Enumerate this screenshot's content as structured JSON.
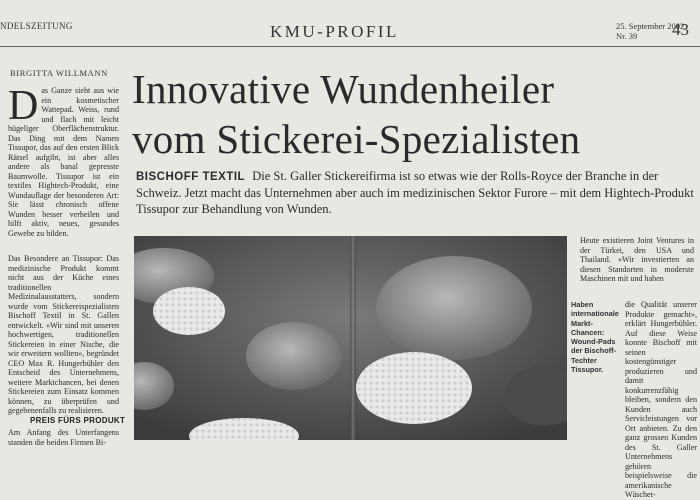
{
  "header": {
    "publication": "NDELSZEITUNG",
    "section": "KMU-PROFIL",
    "date": "25. September 2002",
    "issue": "Nr. 39",
    "page_number": "43"
  },
  "article": {
    "author": "BIRGITTA WILLMANN",
    "headline_line1": "Innovative Wundenheiler",
    "headline_line2": "vom Stickerei-Spezialisten",
    "lead_label": "BISCHOFF TEXTIL",
    "lead_text": "Die St. Galler Stickereifirma ist so etwas wie der Rolls-Royce der Branche in der Schweiz. Jetzt macht das Unternehmen aber auch im medizinischen Sektor Furore – mit dem Hightech-Produkt Tissupor zur Behandlung von Wunden.",
    "dropcap": "D",
    "body_para1": "as Ganze sieht aus wie ein kosmetischer Wattepad. Weiss, rund und flach mit leicht hügeliger Oberflächenstruktur. Das Ding mit dem Namen Tissupor, das auf den ersten Blick Rätsel aufgibt, ist aber alles andere als banal gepresste Baumwolle. Tissupor ist ein textiles Hightech-Produkt, eine Wundauflage der besonderen Art: Sie lässt chronisch offene Wunden besser verheilen und hilft aktiv, neues, gesundes Gewebe zu bilden.",
    "body_para2": "Das Besondere an Tissupor: Das medizinische Produkt kommt nicht aus der Küche eines traditionellen Medizinalausstatters, sondern wurde vom Stickereispezialisten Bischoff Textil in St. Gallen entwickelt. «Wir sind mit unseren hochwertigen, traditionellen Stickereien in einer Nische, die wir erweitern wollten», begründet CEO Max R. Hungerbühler den Entscheid des Unternehmens, weitere Marktchancen, bei denen Stickereien zum Einsatz kommen können, zu überprüfen und gegebenenfalls zu realisieren.",
    "subhead": "PREIS FÜRS PRODUKT",
    "body_para3": "Am Anfang des Unterfangens standen die beiden Firmen Bi-",
    "caption": "Haben internationale Markt-Chancen: Wound-Pads der Bischoff-Techter Tissupor.",
    "right_top": "Heute existieren Joint Ventures in der Türkei, den USA und Thailand. «Wir investierten an diesen Standorten in moderste Maschinen mit und haben",
    "right_col": "die Qualität unserer Produkte gemacht», erklärt Hungerbühler. Auf diese Weise konnte Bischoff mit seinen kostengünstiger produzieren und damit konkurrenzfähig bleiben, sondern den Kunden auch Servicleistungen vor Ort anbieten. Zu den ganz grossen Kunden des St. Galler Unternehmens gehören beispielsweise die amerikanische Wäschet-"
  }
}
